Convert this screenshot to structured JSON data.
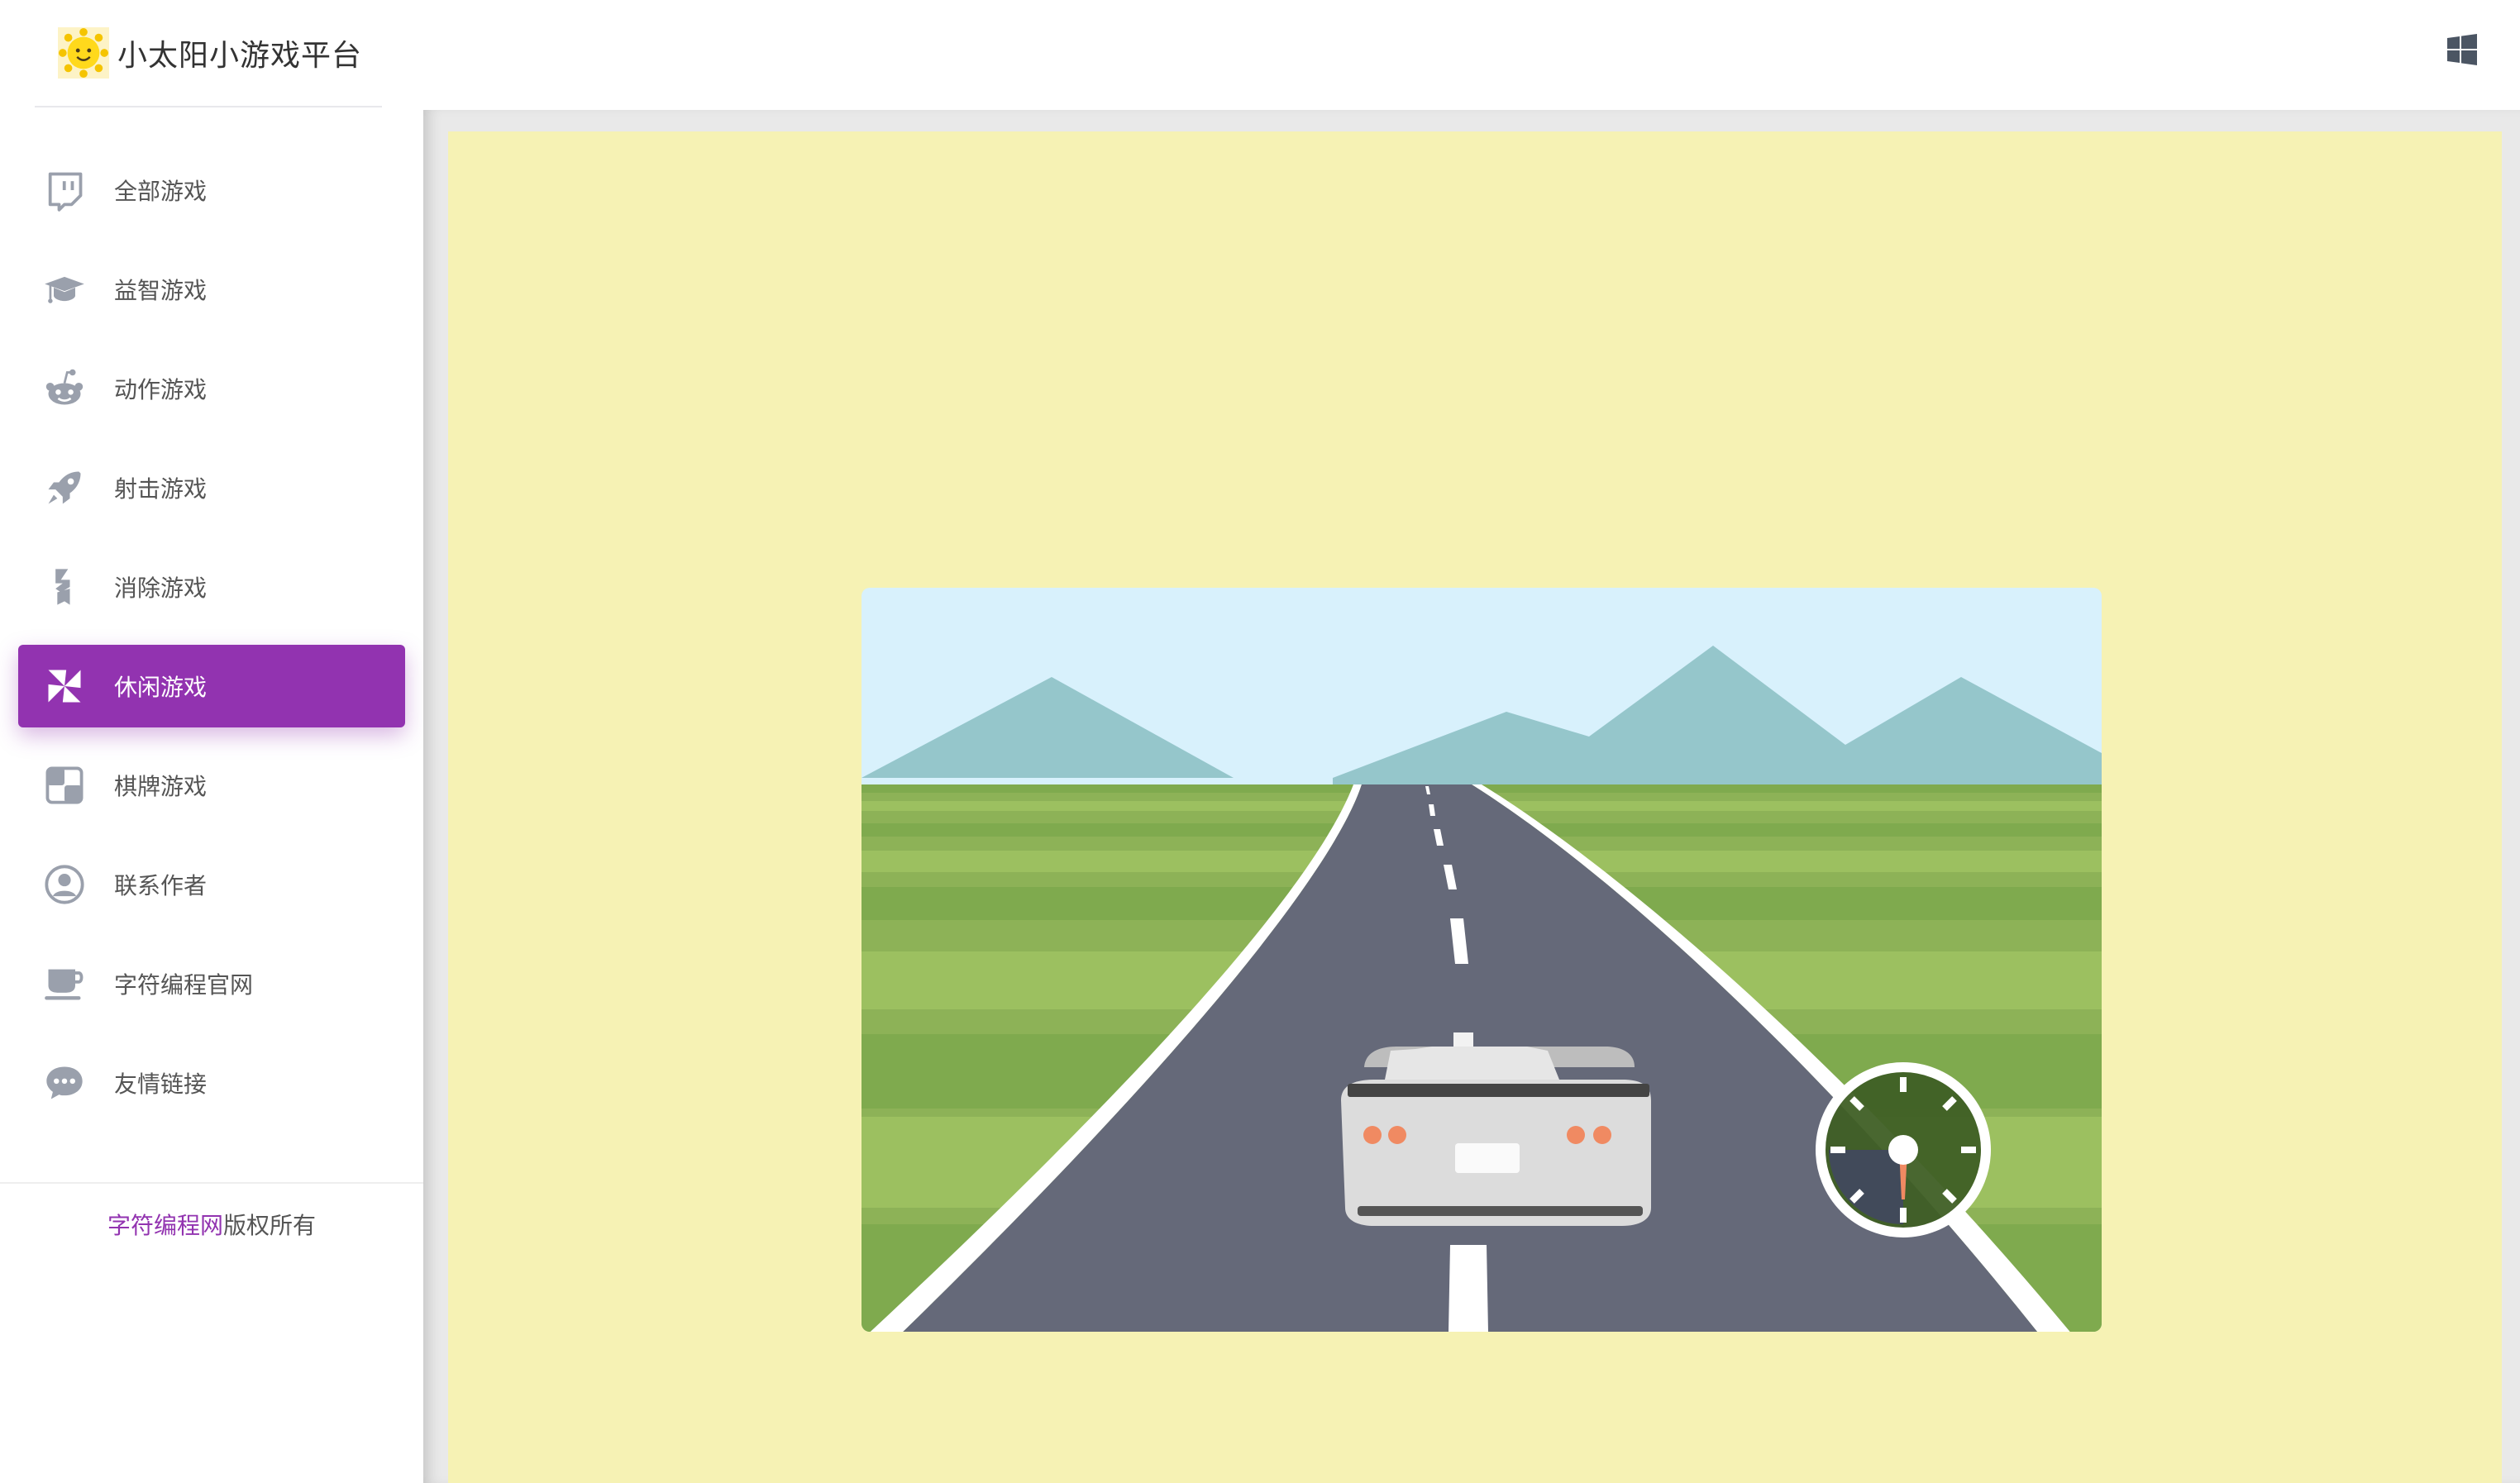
{
  "app": {
    "title": "小太阳小游戏平台"
  },
  "sidebar": {
    "items": [
      {
        "label": "全部游戏",
        "icon": "twitch-icon",
        "active": false
      },
      {
        "label": "益智游戏",
        "icon": "graduation-cap-icon",
        "active": false
      },
      {
        "label": "动作游戏",
        "icon": "reddit-icon",
        "active": false
      },
      {
        "label": "射击游戏",
        "icon": "rocket-icon",
        "active": false
      },
      {
        "label": "消除游戏",
        "icon": "bolt-shape-icon",
        "active": false
      },
      {
        "label": "休闲游戏",
        "icon": "pinwheel-icon",
        "active": true
      },
      {
        "label": "棋牌游戏",
        "icon": "checkerboard-icon",
        "active": false
      },
      {
        "label": "联系作者",
        "icon": "user-circle-icon",
        "active": false
      },
      {
        "label": "字符编程官网",
        "icon": "coffee-cup-icon",
        "active": false
      },
      {
        "label": "友情链接",
        "icon": "chat-bubble-icon",
        "active": false
      }
    ],
    "footer": {
      "link": "字符编程网",
      "suffix": "版权所有"
    }
  },
  "header": {
    "right_icon": "windows-icon"
  },
  "colors": {
    "accent": "#9233b0",
    "game_bg": "#f6f2b4"
  }
}
